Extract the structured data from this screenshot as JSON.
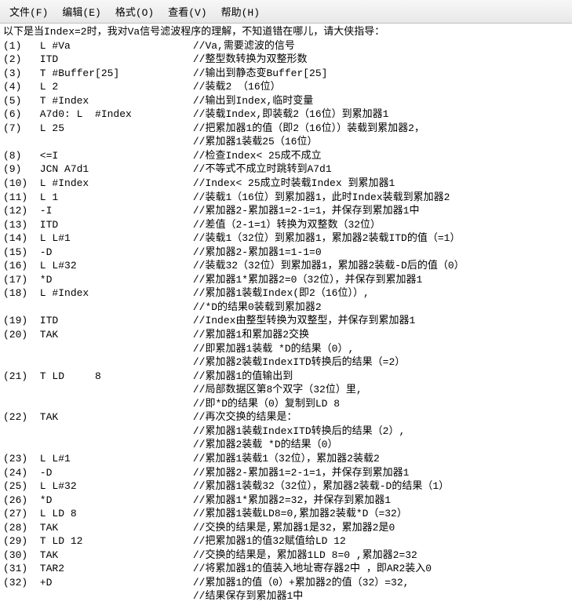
{
  "menu": {
    "items": [
      "文件(F)",
      "编辑(E)",
      "格式(O)",
      "查看(V)",
      "帮助(H)"
    ]
  },
  "intro": "以下是当Index=2时，我对Va信号滤波程序的理解，不知道错在哪儿，请大侠指导：",
  "lines": [
    "(1)   L #Va                    //Va,需要滤波的信号",
    "(2)   ITD                      //整型数转换为双整形数",
    "(3)   T #Buffer[25]            //输出到静态变Buffer[25]",
    "(4)   L 2                      //装载2 （16位）",
    "(5)   T #Index                 //输出到Index,临时变量",
    "(6)   A7d0: L  #Index          //装载Index,即装载2（16位）到累加器1",
    "(7)   L 25                     //把累加器1的值（即2（16位））装载到累加器2，",
    "                               //累加器1装载25（16位）",
    "(8)   <=I                      //检查Index< 25成不成立",
    "(9)   JCN A7d1                 //不等式不成立时跳转到A7d1",
    "(10)  L #Index                 //Index< 25成立时装载Index 到累加器1",
    "(11)  L 1                      //装载1（16位）到累加器1，此时Index装载到累加器2",
    "(12)  -I                       //累加器2-累加器1=2-1=1，并保存到累加器1中",
    "(13)  ITD                      //差值（2-1=1）转换为双整数（32位）",
    "(14)  L L#1                    //装载1（32位）到累加器1，累加器2装载ITD的值（=1）",
    "(15)  -D                       //累加器2-累加器1=1-1=0",
    "(16)  L L#32                   //装载32（32位）到累加器1，累加器2装载-D后的值（0）",
    "(17)  *D                       //累加器1*累加器2=0（32位），并保存到累加器1",
    "(18)  L #Index                 //累加器1装载Index(即2（16位））,",
    "                               //*D的结果0装载到累加器2",
    "(19)  ITD                      //Index由整型转换为双整型，并保存到累加器1",
    "(20)  TAK                      //累加器1和累加器2交换",
    "                               //即累加器1装载 *D的结果（0）,",
    "                               //累加器2装载IndexITD转换后的结果（=2）",
    "(21)  T LD     8               //累加器1的值输出到",
    "                               //局部数据区第8个双字（32位）里,",
    "                               //即*D的结果（0）复制到LD 8",
    "(22)  TAK                      //再次交换的结果是：",
    "                               //累加器1装载IndexITD转换后的结果（2）,",
    "                               //累加器2装载 *D的结果（0）",
    "(23)  L L#1                    //累加器1装载1（32位），累加器2装载2",
    "(24)  -D                       //累加器2-累加器1=2-1=1，并保存到累加器1",
    "(25)  L L#32                   //累加器1装载32（32位），累加器2装载-D的结果（1）",
    "(26)  *D                       //累加器1*累加器2=32，并保存到累加器1",
    "(27)  L LD 8                   //累加器1装载LD8=0,累加器2装载*D（=32）",
    "(28)  TAK                      //交换的结果是,累加器1是32，累加器2是0",
    "(29)  T LD 12                  //把累加器1的值32赋值给LD 12",
    "(30)  TAK                      //交换的结果是，累加器1LD 8=0 ,累加器2=32",
    "(31)  TAR2                     //将累加器1的值装入地址寄存器2中 ，即AR2装入0",
    "(32)  +D                       //累加器1的值（0）+累加器2的值（32）=32,",
    "                               //结果保存到累加器1中"
  ]
}
